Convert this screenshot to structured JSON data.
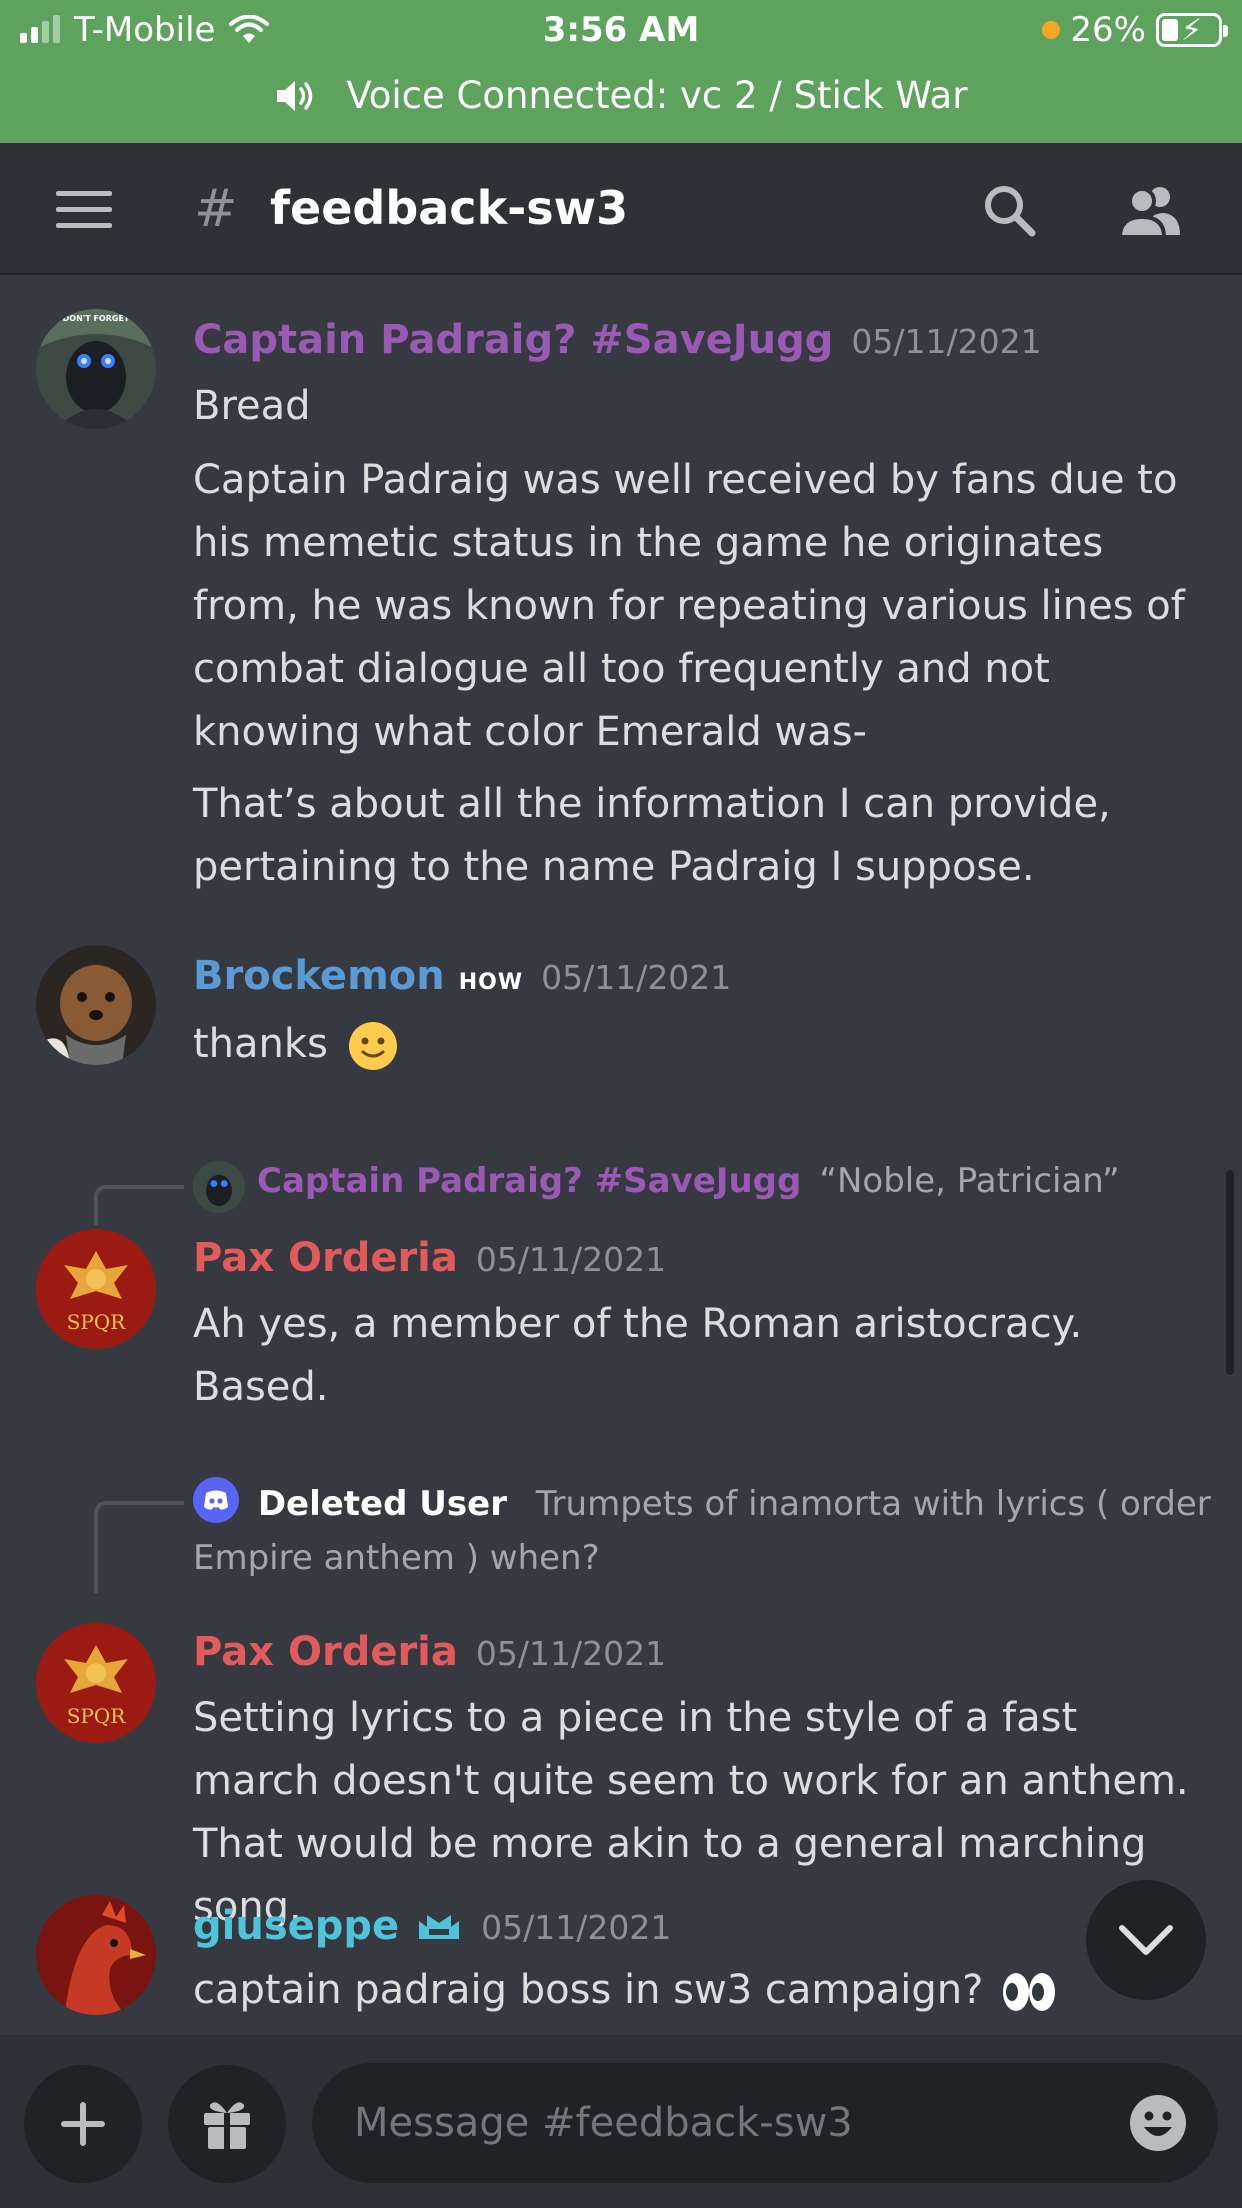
{
  "status_bar": {
    "carrier": "T-Mobile",
    "time": "3:56 AM",
    "battery": "26%"
  },
  "voice": {
    "text": "Voice Connected: vc 2 / Stick War"
  },
  "header": {
    "hash": "#",
    "channel": "feedback-sw3"
  },
  "messages": [
    {
      "author": "Captain Padraig? #SaveJugg",
      "timestamp": "05/11/2021",
      "lines": [
        "Bread",
        "Captain Padraig was well received by fans due to his memetic status in the game he originates from, he was known for repeating various lines of combat dialogue all too frequently and not knowing what color Emerald was-",
        "That’s about all the information I can provide, pertaining to the name Padraig I suppose."
      ],
      "avatar_text": "DON'T FORGET"
    },
    {
      "author": "Brockemon",
      "tag": "HOW",
      "timestamp": "05/11/2021",
      "lines": [
        "thanks"
      ]
    },
    {
      "reply_author": "Captain Padraig? #SaveJugg",
      "reply_text": "“Noble, Patrician”",
      "author": "Pax Orderia",
      "timestamp": "05/11/2021",
      "lines": [
        "Ah yes, a member of the Roman aristocracy. Based."
      ],
      "avatar_text": "SPQR"
    },
    {
      "reply_author": "Deleted User",
      "reply_text": "Trumpets of inamorta with lyrics ( order Empire anthem ) when?",
      "author": "Pax Orderia",
      "timestamp": "05/11/2021",
      "lines": [
        "Setting lyrics to a piece in the style of a fast march doesn't quite seem to work for an anthem. That would be more akin to a general marching song."
      ],
      "avatar_text": "SPQR"
    },
    {
      "author": "giuseppe",
      "timestamp": "05/11/2021",
      "lines": [
        "captain padraig boss in sw3 campaign?"
      ]
    }
  ],
  "composer": {
    "placeholder": "Message #feedback-sw3"
  },
  "colors": {
    "voice_banner": "#5ea35d",
    "background": "#36393f",
    "header": "#2f3136",
    "name_purple": "#9b59b6",
    "name_blue": "#5b9bd5",
    "name_red": "#e35a5a",
    "name_teal": "#4fc3d9"
  },
  "icons": [
    "wifi-icon",
    "speaker-icon",
    "hamburger-icon",
    "search-icon",
    "members-icon",
    "chevron-down-icon",
    "plus-icon",
    "gift-icon",
    "emoji-icon",
    "discord-icon"
  ]
}
